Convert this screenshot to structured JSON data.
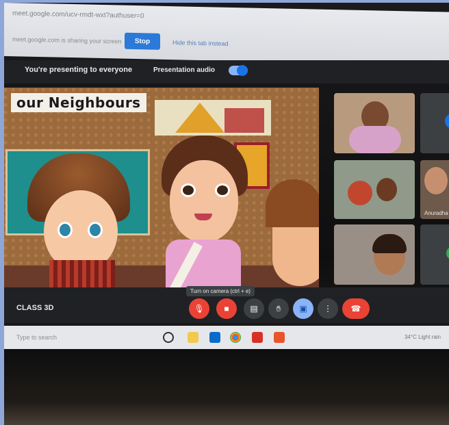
{
  "browser": {
    "url_text": "meet.google.com/ucv-rmdt-wxt?authuser=0",
    "share_text": "meet.google.com is sharing your screen",
    "stop_label": "Stop",
    "hide_label": "Hide this tab instead"
  },
  "meet": {
    "presenting_text": "You're presenting to everyone",
    "audio_label": "Presentation audio",
    "meeting_name": "CLASS 3D",
    "tooltip": "Turn on camera (ctrl + e)"
  },
  "slide": {
    "title": "our Neighbours"
  },
  "participants": [
    {
      "name": ""
    },
    {
      "name": ""
    },
    {
      "name": ""
    },
    {
      "name": "Anuradha"
    },
    {
      "name": ""
    },
    {
      "name": ""
    }
  ],
  "taskbar": {
    "search_text": "Type to search",
    "tray_text": "34°C  Light rain"
  },
  "colors": {
    "meet_dark": "#202124",
    "stop_blue": "#2b79d9",
    "end_call_red": "#ea4335",
    "accent_blue": "#8ab4f8"
  },
  "icons": [
    "mic-off-icon",
    "camera-off-icon",
    "captions-icon",
    "raise-hand-icon",
    "present-icon",
    "more-icon",
    "end-call-icon"
  ]
}
